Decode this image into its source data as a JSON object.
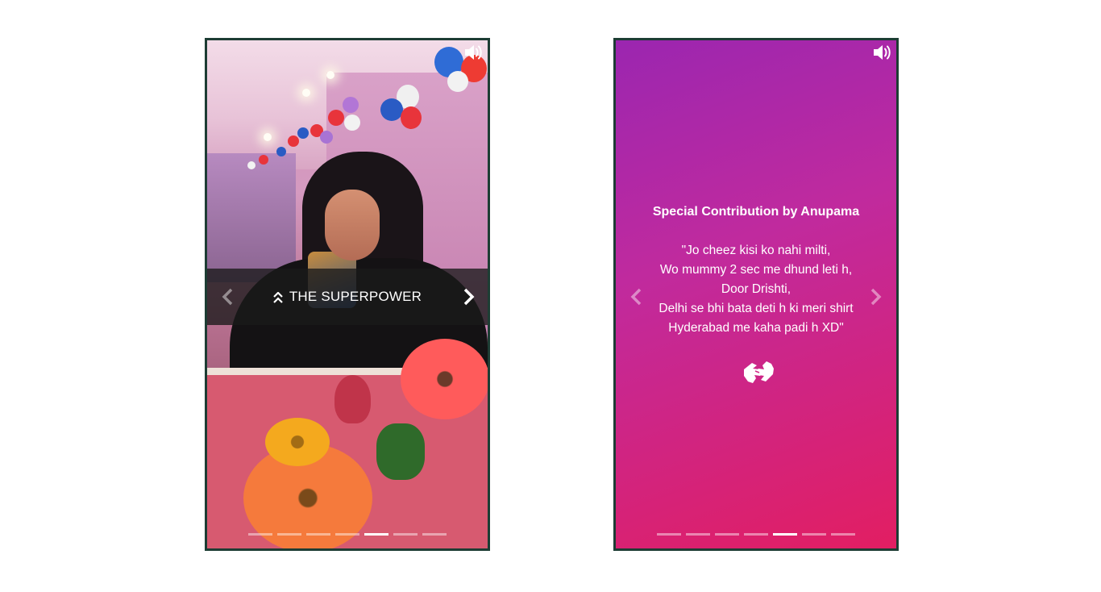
{
  "cards": [
    {
      "overlay_title": "THE SUPERPOWER",
      "progress": {
        "count": 7,
        "active_index": 4
      },
      "icons": {
        "speaker": "speaker-volume-icon",
        "prev": "chevron-left-icon",
        "next": "chevron-right-icon",
        "title": "double-chevron-up-icon"
      }
    },
    {
      "heading": "Special Contribution by Anupama",
      "quote_lines": [
        "\"Jo cheez kisi ko nahi milti,",
        "Wo mummy 2 sec me dhund leti h,",
        "Door Drishti,",
        "Delhi se bhi bata deti h ki meri shirt",
        "Hyderabad me kaha padi h XD\""
      ],
      "progress": {
        "count": 7,
        "active_index": 4
      },
      "gradient": [
        "#9b26b0",
        "#e21e62"
      ],
      "icons": {
        "speaker": "speaker-volume-icon",
        "prev": "chevron-left-icon",
        "next": "chevron-right-icon",
        "sign": "sign-language-icon"
      }
    }
  ]
}
